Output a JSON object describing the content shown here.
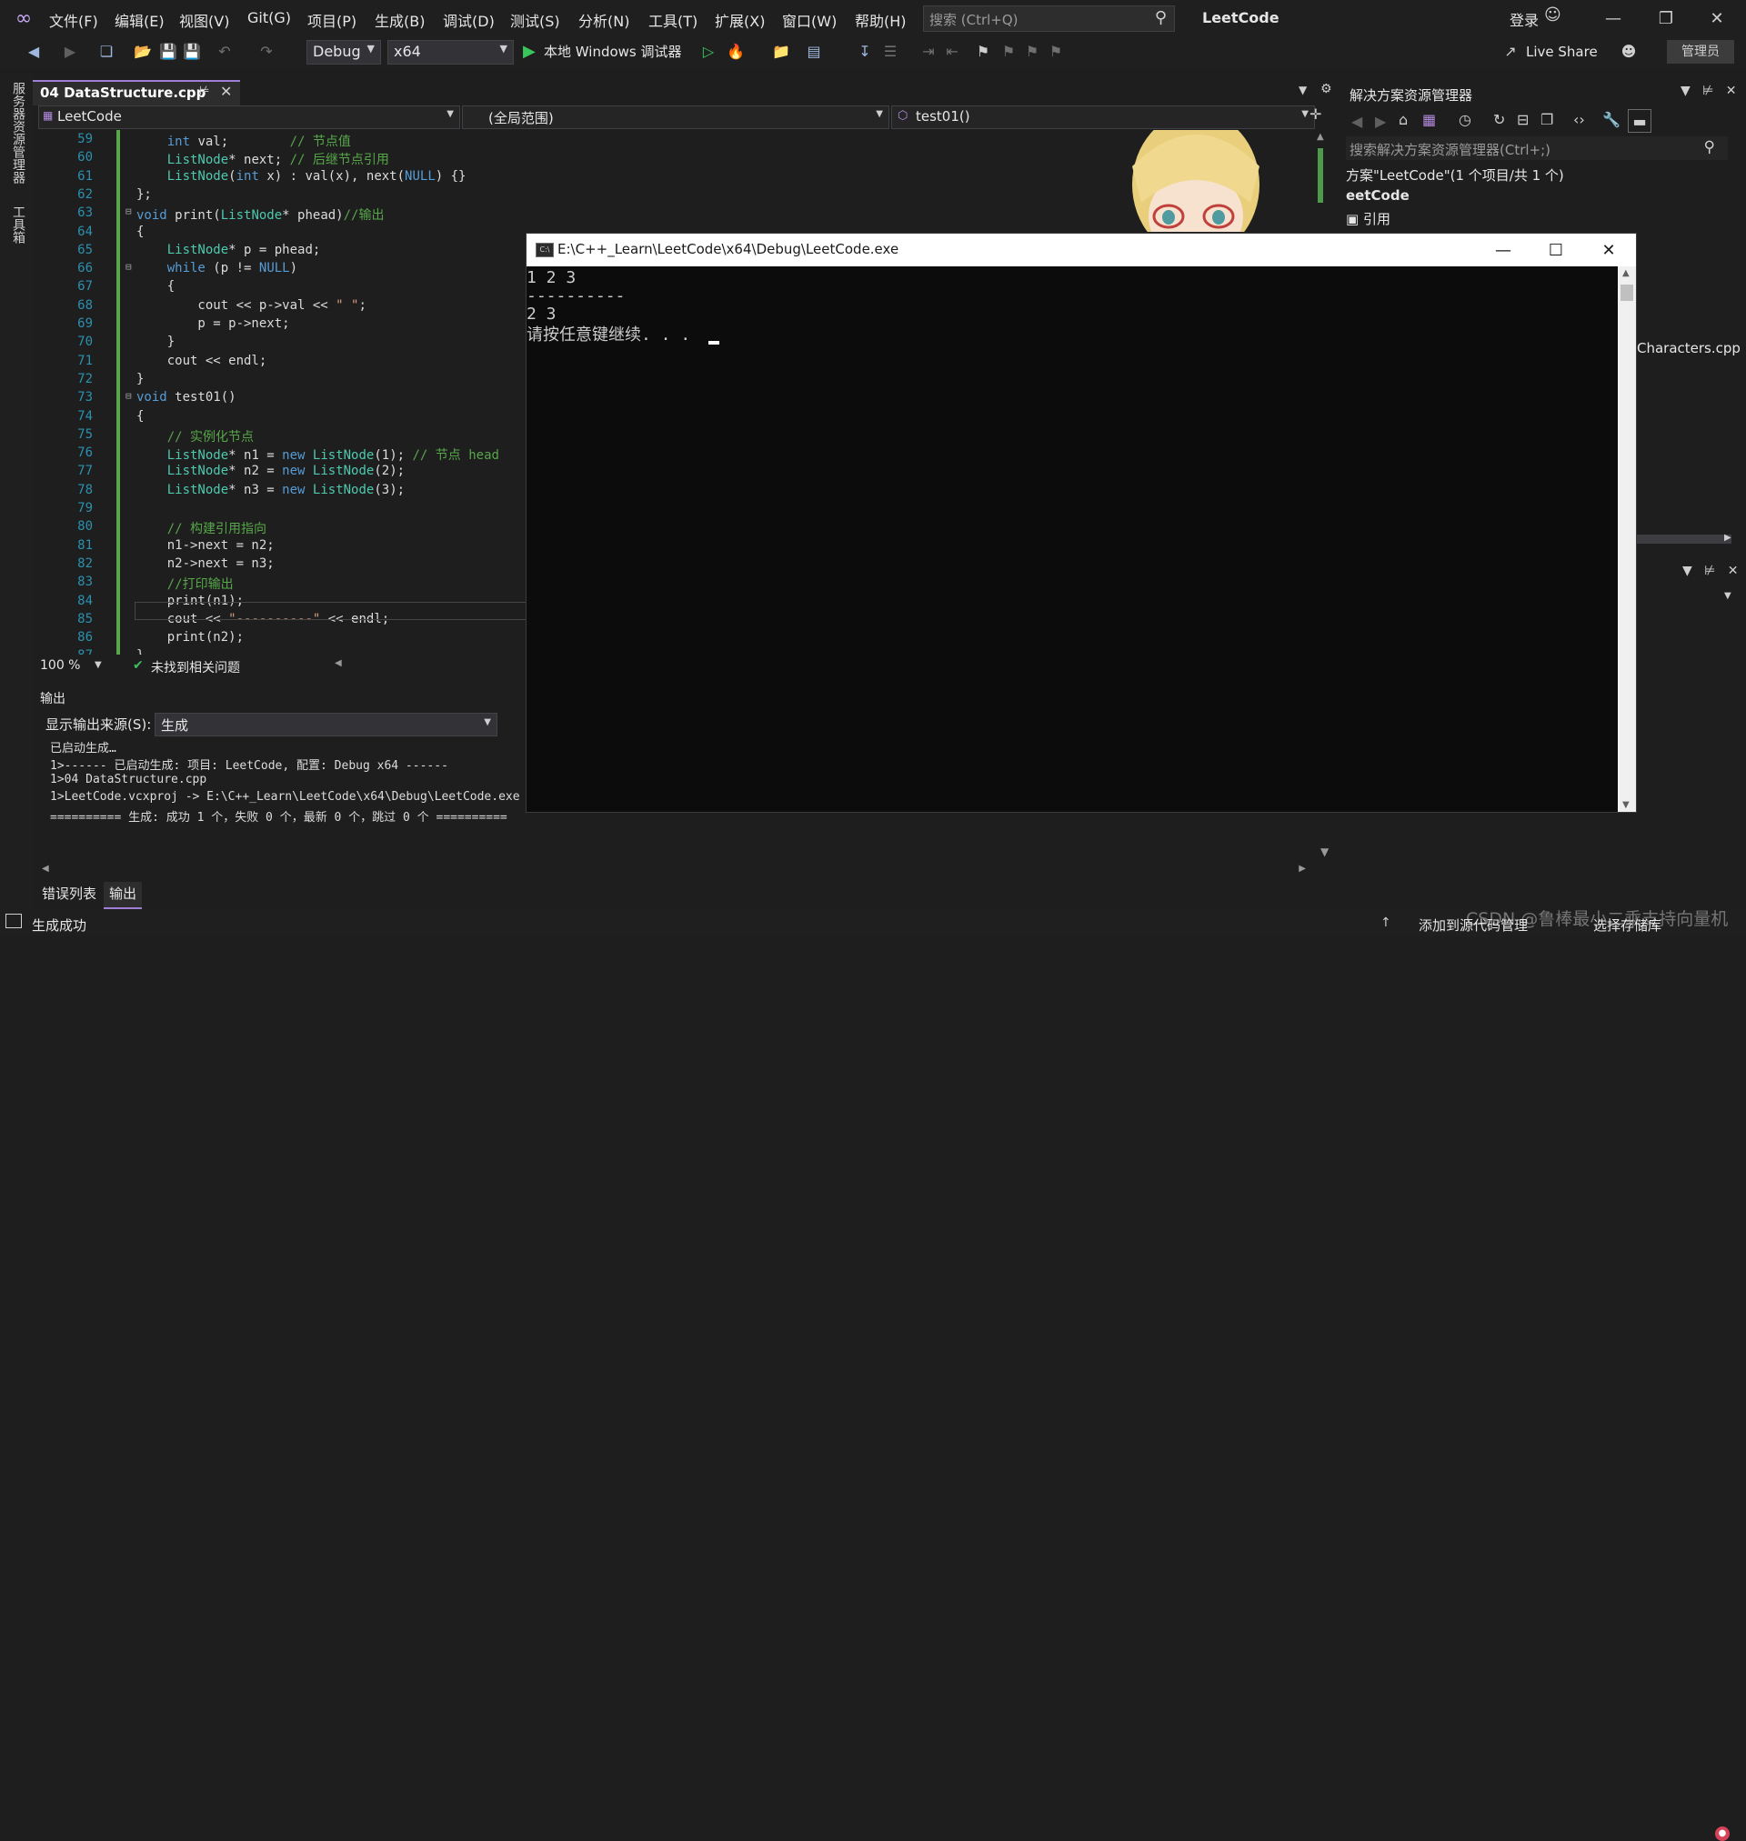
{
  "menubar": {
    "items": [
      "文件(F)",
      "编辑(E)",
      "视图(V)",
      "Git(G)",
      "项目(P)",
      "生成(B)",
      "调试(D)",
      "测试(S)",
      "分析(N)",
      "工具(T)",
      "扩展(X)",
      "窗口(W)",
      "帮助(H)"
    ],
    "search_placeholder": "搜索 (Ctrl+Q)",
    "app_title": "LeetCode",
    "login": "登录"
  },
  "toolbar": {
    "config": "Debug",
    "platform": "x64",
    "run_label": "本地 Windows 调试器",
    "live_share": "Live Share",
    "admin": "管理员"
  },
  "left_strip": {
    "server_explorer": "服务器资源管理器",
    "toolbox": "工具箱"
  },
  "editor": {
    "tab_title": "04 DataStructure.cpp",
    "nav_project": "LeetCode",
    "nav_scope": "(全局范围)",
    "nav_member": "test01()",
    "lines": [
      {
        "n": "59",
        "code": "    int val;        // 节点值"
      },
      {
        "n": "60",
        "code": "    ListNode* next; // 后继节点引用"
      },
      {
        "n": "61",
        "code": "    ListNode(int x) : val(x), next(NULL) {}"
      },
      {
        "n": "62",
        "code": "};"
      },
      {
        "n": "63",
        "code": "void print(ListNode* phead)//输出"
      },
      {
        "n": "64",
        "code": "{"
      },
      {
        "n": "65",
        "code": "    ListNode* p = phead;"
      },
      {
        "n": "66",
        "code": "    while (p != NULL)"
      },
      {
        "n": "67",
        "code": "    {"
      },
      {
        "n": "68",
        "code": "        cout << p->val << \" \";"
      },
      {
        "n": "69",
        "code": "        p = p->next;"
      },
      {
        "n": "70",
        "code": "    }"
      },
      {
        "n": "71",
        "code": "    cout << endl;"
      },
      {
        "n": "72",
        "code": "}"
      },
      {
        "n": "73",
        "code": "void test01()"
      },
      {
        "n": "74",
        "code": "{"
      },
      {
        "n": "75",
        "code": "    // 实例化节点"
      },
      {
        "n": "76",
        "code": "    ListNode* n1 = new ListNode(1); // 节点 head"
      },
      {
        "n": "77",
        "code": "    ListNode* n2 = new ListNode(2);"
      },
      {
        "n": "78",
        "code": "    ListNode* n3 = new ListNode(3);"
      },
      {
        "n": "79",
        "code": ""
      },
      {
        "n": "80",
        "code": "    // 构建引用指向"
      },
      {
        "n": "81",
        "code": "    n1->next = n2;"
      },
      {
        "n": "82",
        "code": "    n2->next = n3;"
      },
      {
        "n": "83",
        "code": "    //打印输出"
      },
      {
        "n": "84",
        "code": "    print(n1);"
      },
      {
        "n": "85",
        "code": "    cout << \"----------\" << endl;"
      },
      {
        "n": "86",
        "code": "    print(n2);"
      },
      {
        "n": "87",
        "code": "}"
      }
    ],
    "zoom": "100 %",
    "issues": "未找到相关问题"
  },
  "output": {
    "title": "输出",
    "source_label": "显示输出来源(S):",
    "source_value": "生成",
    "lines": [
      "已启动生成…",
      "1>------ 已启动生成: 项目: LeetCode, 配置: Debug x64 ------",
      "1>04 DataStructure.cpp",
      "1>LeetCode.vcxproj -> E:\\C++_Learn\\LeetCode\\x64\\Debug\\LeetCode.exe",
      "========== 生成: 成功 1 个，失败 0 个，最新 0 个，跳过 0 个 =========="
    ],
    "tabs": [
      "错误列表",
      "输出"
    ]
  },
  "solution_explorer": {
    "title": "解决方案资源管理器",
    "search_placeholder": "搜索解决方案资源管理器(Ctrl+;)",
    "solution": "方案\"LeetCode\"(1 个项目/共 1 个)",
    "project": "eetCode",
    "references": "引用",
    "file": "Characters.cpp"
  },
  "console": {
    "title": "E:\\C++_Learn\\LeetCode\\x64\\Debug\\LeetCode.exe",
    "lines": [
      "1 2 3",
      "----------",
      "2 3",
      "请按任意键继续. . ."
    ]
  },
  "statusbar": {
    "status": "生成成功",
    "add_source": "添加到源代码管理",
    "select_repo": "选择存储库",
    "watermark": "CSDN @鲁棒最小二乘支持向量机"
  },
  "colors": {
    "keyword": "#569cd6",
    "type": "#4ec9b0",
    "comment": "#57a64a",
    "string": "#d69d85",
    "line_number": "#2b91af",
    "accent": "#9f7fd6"
  }
}
